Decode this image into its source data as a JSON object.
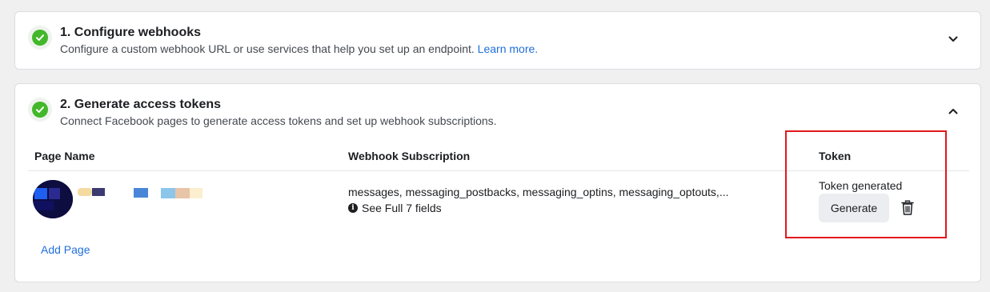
{
  "steps": [
    {
      "title": "1. Configure webhooks",
      "description": "Configure a custom webhook URL or use services that help you set up an endpoint.",
      "link_text": "Learn more.",
      "status": "complete",
      "expanded": false
    },
    {
      "title": "2. Generate access tokens",
      "description": "Connect Facebook pages to generate access tokens and set up webhook subscriptions.",
      "status": "complete",
      "expanded": true
    }
  ],
  "table": {
    "headers": {
      "page_name": "Page Name",
      "webhook_subscription": "Webhook Subscription",
      "token": "Token"
    },
    "rows": [
      {
        "page_name": "",
        "subscription_fields": "messages, messaging_postbacks, messaging_optins, messaging_optouts,...",
        "see_full_label": "See Full 7 fields",
        "token_status": "Token generated",
        "generate_label": "Generate"
      }
    ]
  },
  "add_page_label": "Add Page",
  "colors": {
    "success": "#42b72a",
    "link": "#216fdb",
    "highlight": "#e0191c",
    "background": "#f0f0f0"
  },
  "icons": {
    "check": "check-circle-icon",
    "collapsed": "chevron-down-icon",
    "expanded": "chevron-up-icon",
    "info": "info-icon",
    "delete": "trash-icon"
  }
}
